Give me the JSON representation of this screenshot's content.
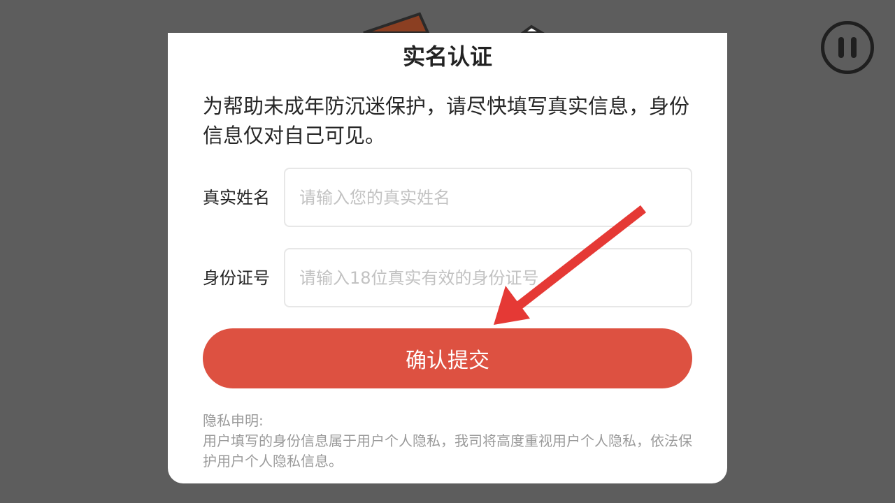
{
  "dialog": {
    "title": "实名认证",
    "notice": "为帮助未成年防沉迷保护，请尽快填写真实信息，身份信息仅对自己可见。",
    "name_label": "真实姓名",
    "name_placeholder": "请输入您的真实姓名",
    "id_label": "身份证号",
    "id_placeholder": "请输入18位真实有效的身份证号",
    "submit_label": "确认提交",
    "privacy_title": "隐私申明:",
    "privacy_text": "用户填写的身份信息属于用户个人隐私，我司将高度重视用户个人隐私，依法保护用户个人隐私信息。"
  },
  "colors": {
    "accent": "#dd5141",
    "annotation_arrow": "#e53935",
    "backdrop": "#5d5d5d"
  },
  "icons": {
    "pause": "pause-icon"
  }
}
